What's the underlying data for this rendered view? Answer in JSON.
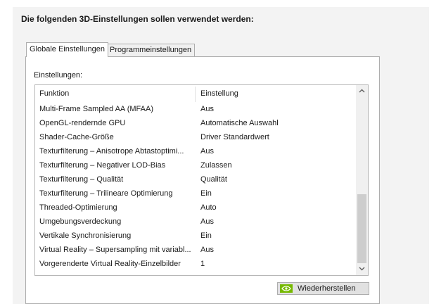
{
  "heading": "Die folgenden 3D-Einstellungen sollen verwendet werden:",
  "tabs": [
    {
      "label": "Globale Einstellungen",
      "active": true
    },
    {
      "label": "Programmeinstellungen",
      "active": false
    }
  ],
  "settings_label": "Einstellungen:",
  "columns": {
    "function": "Funktion",
    "setting": "Einstellung"
  },
  "rows": [
    {
      "function": "Multi-Frame Sampled AA (MFAA)",
      "setting": "Aus"
    },
    {
      "function": "OpenGL-rendernde GPU",
      "setting": "Automatische Auswahl"
    },
    {
      "function": "Shader-Cache-Größe",
      "setting": "Driver Standardwert"
    },
    {
      "function": "Texturfilterung – Anisotrope Abtastoptimi...",
      "setting": "Aus"
    },
    {
      "function": "Texturfilterung – Negativer LOD-Bias",
      "setting": "Zulassen"
    },
    {
      "function": "Texturfilterung – Qualität",
      "setting": "Qualität"
    },
    {
      "function": "Texturfilterung – Trilineare Optimierung",
      "setting": "Ein"
    },
    {
      "function": "Threaded-Optimierung",
      "setting": "Auto"
    },
    {
      "function": "Umgebungsverdeckung",
      "setting": "Aus"
    },
    {
      "function": "Vertikale Synchronisierung",
      "setting": "Ein"
    },
    {
      "function": "Virtual Reality – Supersampling mit variabl...",
      "setting": "Aus"
    },
    {
      "function": "Vorgerenderte Virtual Reality-Einzelbilder",
      "setting": "1"
    }
  ],
  "scrollbar": {
    "up_arrow": "⌃",
    "down_arrow": "⌄"
  },
  "restore_button": {
    "label": "Wiederherstellen",
    "icon": "nvidia-logo-icon"
  },
  "colors": {
    "panel_bg": "#f3f3f3",
    "nvidia_green": "#76b900",
    "button_bg": "#e1e1e1"
  }
}
